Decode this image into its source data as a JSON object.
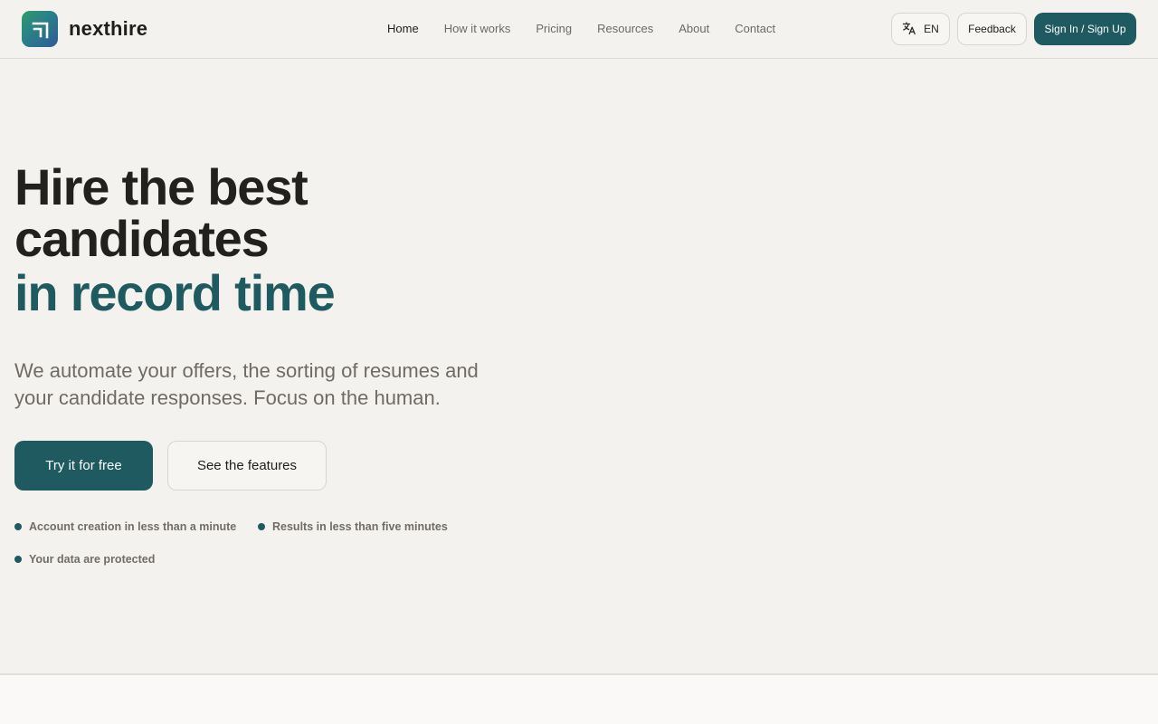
{
  "brand": {
    "name": "nexthire",
    "logo_icon": "corner-arrow-logo-icon",
    "colors": {
      "primary": "#1e5a60",
      "gradient_start": "#2f9a6b",
      "gradient_end": "#2e5a98"
    }
  },
  "nav": {
    "items": [
      {
        "label": "Home",
        "active": true
      },
      {
        "label": "How it works",
        "active": false
      },
      {
        "label": "Pricing",
        "active": false
      },
      {
        "label": "Resources",
        "active": false
      },
      {
        "label": "About",
        "active": false
      },
      {
        "label": "Contact",
        "active": false
      }
    ]
  },
  "header_actions": {
    "language": {
      "icon": "translate-icon",
      "label": "EN"
    },
    "feedback_label": "Feedback",
    "signin_label": "Sign In / Sign Up"
  },
  "hero": {
    "title_line1": "Hire the best",
    "title_line2": "candidates",
    "title_accent": "in record time",
    "subtitle_line1": "We automate your offers, the sorting of resumes and",
    "subtitle_line2": "your candidate responses. Focus on the human.",
    "primary_cta": "Try it for free",
    "secondary_cta": "See the features",
    "features": [
      "Account creation in less than a minute",
      "Results in less than five minutes",
      "Your data are protected"
    ]
  }
}
